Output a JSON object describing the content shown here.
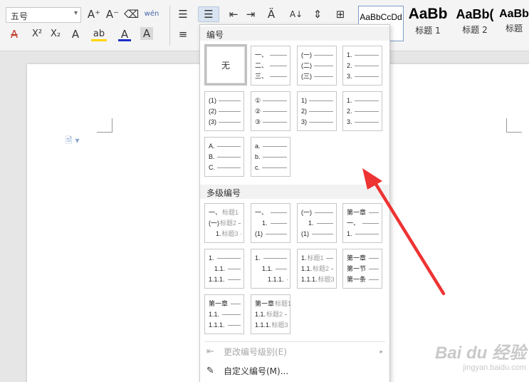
{
  "ribbon": {
    "font_size": "五号",
    "font_size_dropdown": "▾",
    "row1": [
      {
        "name": "grow-font-icon",
        "glyph": "A⁺"
      },
      {
        "name": "shrink-font-icon",
        "glyph": "A⁻"
      },
      {
        "name": "eraser-icon",
        "glyph": "⌫"
      },
      {
        "name": "phonetic-guide-icon",
        "glyph": "wén"
      },
      {
        "name": "bullet-list-icon",
        "glyph": "☰"
      },
      {
        "name": "numbered-list-icon",
        "glyph": "☰"
      },
      {
        "name": "decrease-indent-icon",
        "glyph": "⇤"
      },
      {
        "name": "increase-indent-icon",
        "glyph": "⇥"
      },
      {
        "name": "char-shading-icon",
        "glyph": "Ä"
      },
      {
        "name": "sort-icon",
        "glyph": "A↓"
      },
      {
        "name": "line-spacing-icon",
        "glyph": "⇕"
      },
      {
        "name": "borders-icon",
        "glyph": "⊞"
      }
    ],
    "row2": [
      {
        "name": "strikethrough-icon",
        "glyph": "A"
      },
      {
        "name": "superscript-icon",
        "glyph": "X²"
      },
      {
        "name": "subscript-icon",
        "glyph": "X₂"
      },
      {
        "name": "text-effect-icon",
        "glyph": "A"
      },
      {
        "name": "highlight-icon",
        "glyph": "ab"
      },
      {
        "name": "font-color-icon",
        "glyph": "A"
      },
      {
        "name": "char-border-icon",
        "glyph": "A"
      },
      {
        "name": "align-left-icon",
        "glyph": "≡"
      }
    ],
    "styles": [
      {
        "sample": "AaBbCcDd",
        "name": ""
      },
      {
        "sample": "AaBb",
        "name": "标题 1"
      },
      {
        "sample": "AaBb(",
        "name": "标题 2"
      },
      {
        "sample": "AaBb",
        "name": "标题"
      }
    ]
  },
  "document": {
    "paragraph_icon": "🗎 ▾"
  },
  "menu": {
    "section1_title": "编号",
    "section2_title": "多级编号",
    "none_label": "无",
    "simple_tiles": [
      [
        "一、",
        "二、",
        "三、"
      ],
      [
        "(一)",
        "(二)",
        "(三)"
      ],
      [
        "1.",
        "2.",
        "3."
      ],
      [
        "(1)",
        "(2)",
        "(3)"
      ],
      [
        "①",
        "②",
        "③"
      ],
      [
        "1)",
        "2)",
        "3)"
      ],
      [
        "1.",
        "2.",
        "3."
      ],
      [
        "A.",
        "B.",
        "C."
      ],
      [
        "a.",
        "b.",
        "c."
      ]
    ],
    "multilevel_tiles": [
      [
        [
          "一、",
          "标题1"
        ],
        [
          "(一)",
          "标题2"
        ],
        [
          "1.",
          "标题3"
        ]
      ],
      [
        [
          "一、",
          ""
        ],
        [
          "1.",
          ""
        ],
        [
          "(1)",
          ""
        ]
      ],
      [
        [
          "(一)",
          ""
        ],
        [
          "1.",
          ""
        ],
        [
          "(1)",
          ""
        ]
      ],
      [
        [
          "第一章",
          ""
        ],
        [
          "一、",
          ""
        ],
        [
          "1.",
          ""
        ]
      ],
      [
        [
          "1.",
          ""
        ],
        [
          "1.1.",
          ""
        ],
        [
          "1.1.1.",
          ""
        ]
      ],
      [
        [
          "1.",
          ""
        ],
        [
          "1.1.",
          ""
        ],
        [
          "1.1.1.",
          ""
        ]
      ],
      [
        [
          "1.",
          "标题1"
        ],
        [
          "1.1.",
          "标题2"
        ],
        [
          "1.1.1.",
          "标题3"
        ]
      ],
      [
        [
          "第一章",
          ""
        ],
        [
          "第一节",
          ""
        ],
        [
          "第一条",
          ""
        ]
      ],
      [
        [
          "第一章",
          ""
        ],
        [
          "1.1.",
          ""
        ],
        [
          "1.1.1.",
          ""
        ]
      ],
      [
        [
          "第一章",
          "标题1"
        ],
        [
          "1.1.",
          "标题2"
        ],
        [
          "1.1.1.",
          "标题3"
        ]
      ]
    ],
    "change_level": {
      "label": "更改编号级别(E)",
      "arrow": "▸",
      "icon": "⇤"
    },
    "custom_numbering": {
      "label": "自定义编号(M)...",
      "icon": "✎"
    }
  },
  "watermark": {
    "main": "Bai du 经验",
    "sub": "jingyan.baidu.com"
  }
}
